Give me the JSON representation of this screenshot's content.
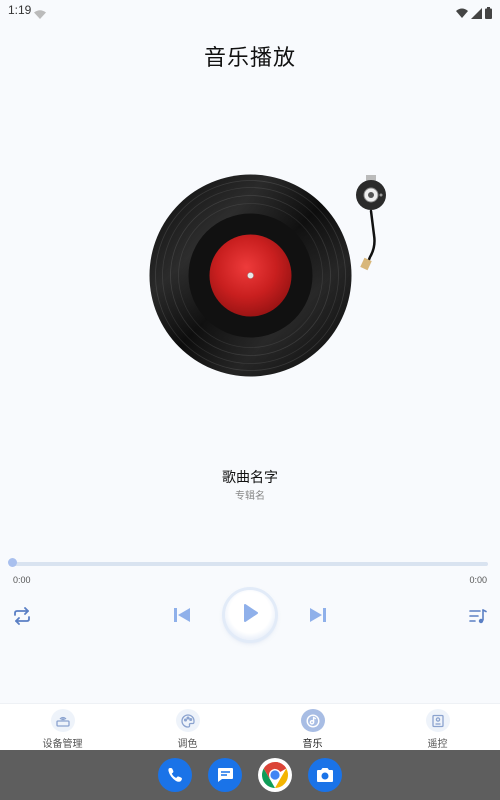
{
  "status_bar": {
    "time": "1:19"
  },
  "header": {
    "title": "音乐播放"
  },
  "song": {
    "name": "歌曲名字",
    "album": "专辑名"
  },
  "player": {
    "current_time": "0:00",
    "total_time": "0:00",
    "progress": 0,
    "icons": {
      "repeat": "repeat-icon",
      "prev": "skip-previous-icon",
      "play": "play-icon",
      "next": "skip-next-icon",
      "playlist": "playlist-icon"
    }
  },
  "nav": {
    "items": [
      {
        "label": "设备管理",
        "icon": "router-icon",
        "active": false
      },
      {
        "label": "调色",
        "icon": "palette-icon",
        "active": false
      },
      {
        "label": "音乐",
        "icon": "music-disc-icon",
        "active": true
      },
      {
        "label": "遥控",
        "icon": "remote-icon",
        "active": false
      }
    ]
  },
  "dock": {
    "apps": [
      {
        "name": "phone-app",
        "color": "#1a73e8"
      },
      {
        "name": "messages-app",
        "color": "#1a73e8"
      },
      {
        "name": "chrome-app",
        "color": "#ffffff"
      },
      {
        "name": "camera-app",
        "color": "#1a73e8"
      }
    ]
  },
  "colors": {
    "accent": "#a8bde4",
    "control_blue": "#8fb0ea",
    "background": "#f8fafd",
    "record_label": "#d42a2a"
  }
}
